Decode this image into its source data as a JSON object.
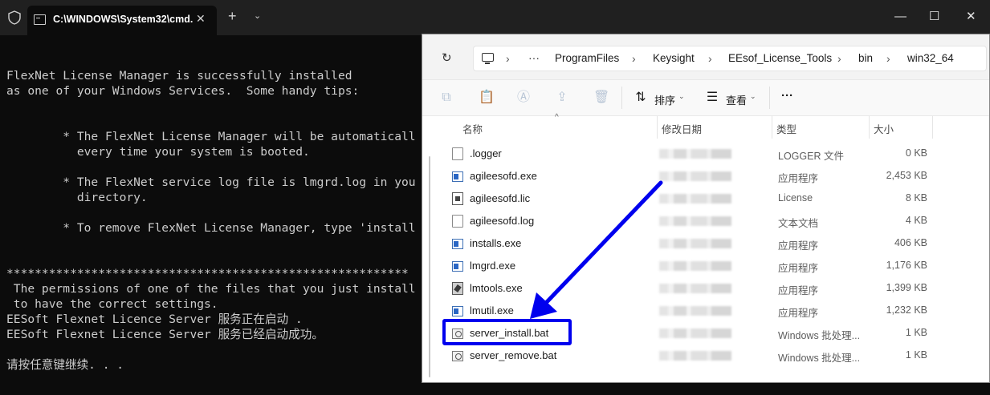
{
  "terminal": {
    "tab_title": "C:\\WINDOWS\\System32\\cmd.",
    "tab_close": "✕",
    "new_tab": "+",
    "tab_dropdown": "⌄",
    "window_controls": {
      "minimize": "—",
      "maximize": "☐",
      "close": "✕"
    },
    "lines": [
      "",
      "FlexNet License Manager is successfully installed",
      "as one of your Windows Services.  Some handy tips:",
      "",
      "",
      "        * The FlexNet License Manager will be automaticall",
      "          every time your system is booted.",
      "",
      "        * The FlexNet service log file is lmgrd.log in you",
      "          directory.",
      "",
      "        * To remove FlexNet License Manager, type 'install",
      "",
      "",
      "*********************************************************",
      " The permissions of one of the files that you just install",
      " to have the correct settings.",
      "EESoft Flexnet Licence Server 服务正在启动 .",
      "EESoft Flexnet Licence Server 服务已经启动成功。",
      "",
      "请按任意键继续. . ."
    ]
  },
  "explorer": {
    "refresh_icon": "↻",
    "breadcrumb": [
      "ProgramFiles",
      "Keysight",
      "EEsof_License_Tools",
      "bin",
      "win32_64"
    ],
    "breadcrumb_separator": "›",
    "more_icon": "···",
    "toolbar": {
      "sort_label": "排序",
      "view_label": "查看",
      "more_options": "···"
    },
    "columns": {
      "name": "名称",
      "date": "修改日期",
      "type": "类型",
      "size": "大小"
    },
    "files": [
      {
        "name": ".logger",
        "type": "LOGGER 文件",
        "size": "0 KB",
        "icon": "doc"
      },
      {
        "name": "agileesofd.exe",
        "type": "应用程序",
        "size": "2,453 KB",
        "icon": "exe"
      },
      {
        "name": "agileesofd.lic",
        "type": "License",
        "size": "8 KB",
        "icon": "lic"
      },
      {
        "name": "agileesofd.log",
        "type": "文本文档",
        "size": "4 KB",
        "icon": "doc"
      },
      {
        "name": "installs.exe",
        "type": "应用程序",
        "size": "406 KB",
        "icon": "exe"
      },
      {
        "name": "lmgrd.exe",
        "type": "应用程序",
        "size": "1,176 KB",
        "icon": "exe"
      },
      {
        "name": "lmtools.exe",
        "type": "应用程序",
        "size": "1,399 KB",
        "icon": "tool"
      },
      {
        "name": "lmutil.exe",
        "type": "应用程序",
        "size": "1,232 KB",
        "icon": "exe"
      },
      {
        "name": "server_install.bat",
        "type": "Windows 批处理...",
        "size": "1 KB",
        "icon": "bat"
      },
      {
        "name": "server_remove.bat",
        "type": "Windows 批处理...",
        "size": "1 KB",
        "icon": "bat"
      }
    ]
  },
  "annotation": {
    "color": "#0000ee"
  }
}
